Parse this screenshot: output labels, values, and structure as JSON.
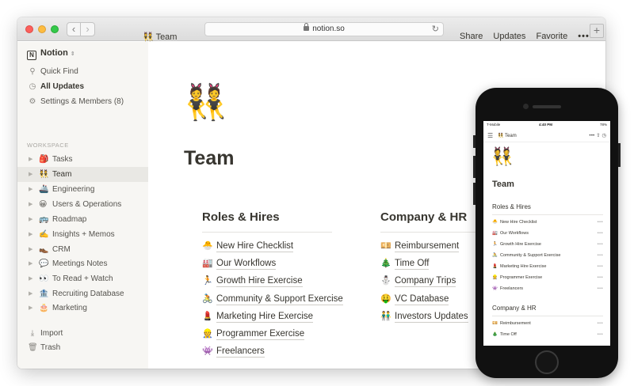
{
  "browser": {
    "url": "notion.so",
    "reload_icon": "reload-icon",
    "back_icon": "chevron-left-icon",
    "forward_icon": "chevron-right-icon",
    "new_tab_icon": "plus-icon"
  },
  "sidebar": {
    "workspace_name": "Notion",
    "top_items": [
      {
        "icon": "search-icon",
        "label": "Quick Find"
      },
      {
        "icon": "clock-icon",
        "label": "All Updates"
      },
      {
        "icon": "gear-icon",
        "label": "Settings & Members (8)"
      }
    ],
    "workspace_label": "WORKSPACE",
    "pages": [
      {
        "emoji": "🎒",
        "label": "Tasks"
      },
      {
        "emoji": "👯",
        "label": "Team"
      },
      {
        "emoji": "🚢",
        "label": "Engineering"
      },
      {
        "emoji": "😀",
        "label": "Users & Operations"
      },
      {
        "emoji": "🚌",
        "label": "Roadmap"
      },
      {
        "emoji": "✍️",
        "label": "Insights + Memos"
      },
      {
        "emoji": "👞",
        "label": "CRM"
      },
      {
        "emoji": "💬",
        "label": "Meetings Notes"
      },
      {
        "emoji": "👀",
        "label": "To Read + Watch"
      },
      {
        "emoji": "🏦",
        "label": "Recruiting Database"
      },
      {
        "emoji": "🎂",
        "label": "Marketing"
      }
    ],
    "bottom_items": [
      {
        "icon": "import-icon",
        "label": "Import"
      },
      {
        "icon": "trash-icon",
        "label": "Trash"
      }
    ]
  },
  "topbar": {
    "page_emoji": "👯",
    "page_title": "Team",
    "share": "Share",
    "updates": "Updates",
    "favorite": "Favorite",
    "more": "•••"
  },
  "page": {
    "emoji": "👯",
    "title": "Team",
    "roles_heading": "Roles & Hires",
    "roles": [
      {
        "emoji": "🐣",
        "label": "New Hire Checklist"
      },
      {
        "emoji": "🏭",
        "label": "Our Workflows"
      },
      {
        "emoji": "🏃",
        "label": "Growth Hire Exercise"
      },
      {
        "emoji": "🚴",
        "label": "Community & Support Exercise"
      },
      {
        "emoji": "💄",
        "label": "Marketing Hire Exercise"
      },
      {
        "emoji": "👷",
        "label": "Programmer Exercise"
      },
      {
        "emoji": "👾",
        "label": "Freelancers"
      }
    ],
    "company_heading": "Company & HR",
    "company": [
      {
        "emoji": "💴",
        "label": "Reimbursement"
      },
      {
        "emoji": "🎄",
        "label": "Time Off"
      },
      {
        "emoji": "⛄",
        "label": "Company Trips"
      },
      {
        "emoji": "🤑",
        "label": "VC Database"
      },
      {
        "emoji": "👬",
        "label": "Investors Updates"
      }
    ]
  },
  "phone": {
    "carrier": "T-Mobile",
    "time": "4:40 PM",
    "battery": "78%",
    "nav_title": "Team",
    "nav_emoji": "👯",
    "more": "•••",
    "title": "Team",
    "roles_heading": "Roles & Hires",
    "roles": [
      {
        "emoji": "🐣",
        "label": "New Hire Checklist"
      },
      {
        "emoji": "🏭",
        "label": "Our Workflows"
      },
      {
        "emoji": "🏃",
        "label": "Growth Hire Exercise"
      },
      {
        "emoji": "🚴",
        "label": "Community & Support Exercise"
      },
      {
        "emoji": "💄",
        "label": "Marketing Hire Exercise"
      },
      {
        "emoji": "👷",
        "label": "Programmer Exercise"
      },
      {
        "emoji": "👾",
        "label": "Freelancers"
      }
    ],
    "company_heading": "Company & HR",
    "company": [
      {
        "emoji": "💴",
        "label": "Reimbursement"
      },
      {
        "emoji": "🎄",
        "label": "Time Off"
      }
    ]
  }
}
